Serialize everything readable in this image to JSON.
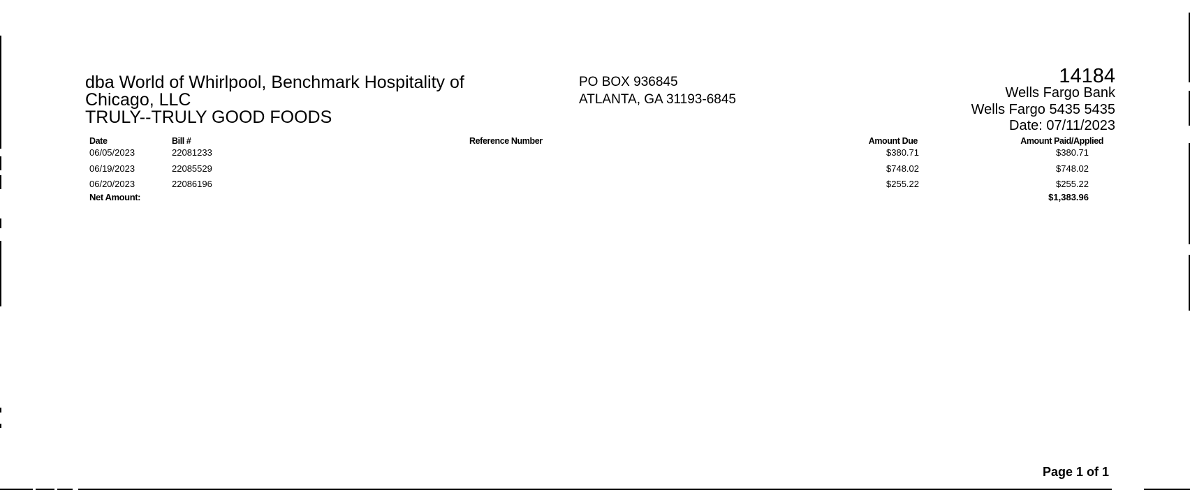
{
  "payee": {
    "lines": [
      "dba World of Whirlpool, Benchmark Hospitality of",
      "Chicago, LLC",
      "TRULY--TRULY GOOD FOODS"
    ]
  },
  "remit_address": {
    "lines": [
      "PO BOX 936845",
      "ATLANTA, GA 31193-6845"
    ]
  },
  "check": {
    "number": "14184",
    "bank": "Wells Fargo Bank",
    "account": "Wells Fargo 5435  5435",
    "date": "Date: 07/11/2023"
  },
  "table": {
    "headers": {
      "date": "Date",
      "bill": "Bill #",
      "reference": "Reference Number",
      "amount_due": "Amount Due",
      "amount_paid": "Amount Paid/Applied"
    },
    "rows": [
      {
        "date": "06/05/2023",
        "bill": "22081233",
        "amount_due": "$380.71",
        "amount_paid": "$380.71"
      },
      {
        "date": "06/19/2023",
        "bill": "22085529",
        "amount_due": "$748.02",
        "amount_paid": "$748.02"
      },
      {
        "date": "06/20/2023",
        "bill": "22086196",
        "amount_due": "$255.22",
        "amount_paid": "$255.22"
      }
    ],
    "net_label": "Net Amount:",
    "net_total": "$1,383.96"
  },
  "footer": {
    "page": "Page 1 of 1"
  }
}
